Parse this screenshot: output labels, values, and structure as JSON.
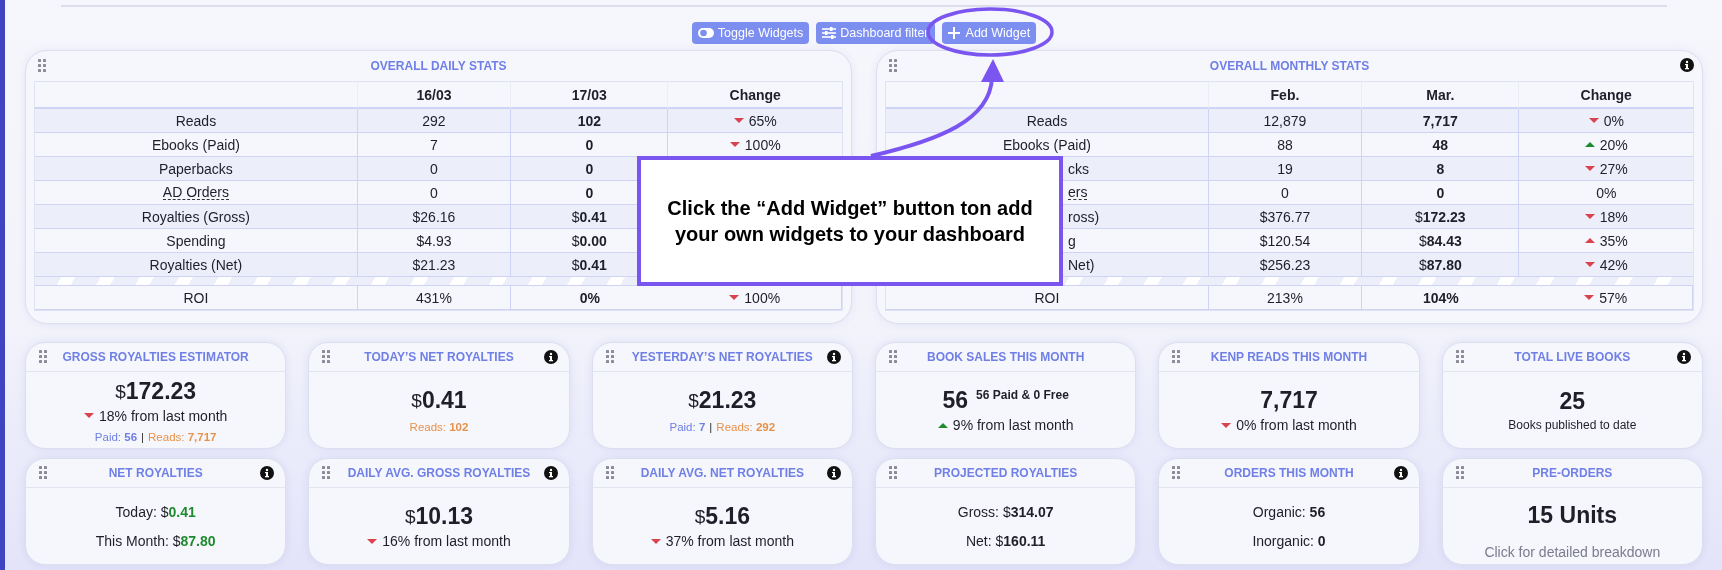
{
  "toolbar": {
    "buttons": [
      {
        "kind": "toggle",
        "label": "Toggle Widgets"
      },
      {
        "kind": "filter",
        "label": "Dashboard filter"
      },
      {
        "kind": "add",
        "label": "Add Widget"
      }
    ]
  },
  "daily_stats": {
    "title": "OVERALL DAILY STATS",
    "info": false,
    "columns": [
      "16/03",
      "17/03",
      "Change"
    ],
    "rows": [
      {
        "label": "Reads",
        "cut": false,
        "tooltip": false,
        "values": [
          "292",
          "102"
        ],
        "change": {
          "text": "65%",
          "arrow": true,
          "up": false,
          "color": "#d9434e"
        }
      },
      {
        "label": "Ebooks (Paid)",
        "cut": false,
        "tooltip": false,
        "values": [
          "7",
          "0"
        ],
        "change": {
          "text": "100%",
          "arrow": true,
          "up": false,
          "color": "#d9434e"
        }
      },
      {
        "label": "Paperbacks",
        "cut": false,
        "tooltip": false,
        "values": [
          "0",
          "0"
        ]
      },
      {
        "label": "AD Orders",
        "cut": false,
        "tooltip": true,
        "values": [
          "0",
          "0"
        ]
      },
      {
        "label": "Royalties (Gross)",
        "cut": false,
        "tooltip": false,
        "values": [
          {
            "prefix": "$",
            "text": "26.16"
          },
          {
            "prefix": "$",
            "text": "0.41"
          }
        ]
      },
      {
        "label": "Spending",
        "cut": false,
        "tooltip": false,
        "values": [
          {
            "prefix": "$",
            "text": "4.93"
          },
          {
            "prefix": "$",
            "text": "0.00"
          }
        ]
      },
      {
        "label": "Royalties (Net)",
        "cut": false,
        "tooltip": false,
        "values": [
          {
            "prefix": "$",
            "text": "21.23"
          },
          {
            "prefix": "$",
            "text": "0.41"
          }
        ]
      },
      {
        "label": "ROI",
        "cut": false,
        "tooltip": false,
        "values": [
          "431%",
          "0%"
        ],
        "change": {
          "text": "100%",
          "arrow": true,
          "up": false,
          "color": "#d9434e"
        }
      }
    ]
  },
  "monthly_stats": {
    "title": "OVERALL MONTHLY STATS",
    "info": true,
    "columns": [
      "Feb.",
      "Mar.",
      "Change"
    ],
    "rows": [
      {
        "label": "Reads",
        "cut": false,
        "tooltip": false,
        "values": [
          "12,879",
          "7,717"
        ],
        "change": {
          "text": "0%",
          "arrow": true,
          "up": false,
          "color": "#d9434e"
        }
      },
      {
        "label": "Ebooks (Paid)",
        "cut": false,
        "tooltip": false,
        "values": [
          "88",
          "48"
        ],
        "change": {
          "text": "20%",
          "arrow": true,
          "up": true,
          "color": "#1e8a2e"
        }
      },
      {
        "label": "cks",
        "cut": true,
        "tooltip": false,
        "values": [
          "19",
          "8"
        ],
        "change": {
          "text": "27%",
          "arrow": true,
          "up": false,
          "color": "#d9434e"
        }
      },
      {
        "label": "ers",
        "cut": true,
        "tooltip": true,
        "values": [
          "0",
          "0"
        ],
        "change": {
          "text": "0%",
          "arrow": false
        }
      },
      {
        "label": "ross)",
        "cut": true,
        "tooltip": false,
        "values": [
          {
            "prefix": "$",
            "text": "376.77"
          },
          {
            "prefix": "$",
            "text": "172.23"
          }
        ],
        "change": {
          "text": "18%",
          "arrow": true,
          "up": false,
          "color": "#d9434e"
        }
      },
      {
        "label": "g",
        "cut": true,
        "tooltip": false,
        "values": [
          {
            "prefix": "$",
            "text": "120.54"
          },
          {
            "prefix": "$",
            "text": "84.43"
          }
        ],
        "change": {
          "text": "35%",
          "arrow": true,
          "up": true,
          "color": "#d9434e"
        }
      },
      {
        "label": "Net)",
        "cut": true,
        "tooltip": false,
        "values": [
          {
            "prefix": "$",
            "text": "256.23"
          },
          {
            "prefix": "$",
            "text": "87.80"
          }
        ],
        "change": {
          "text": "42%",
          "arrow": true,
          "up": false,
          "color": "#d9434e"
        }
      },
      {
        "label": "ROI",
        "cut": false,
        "tooltip": false,
        "values": [
          "213%",
          "104%"
        ],
        "change": {
          "text": "57%",
          "arrow": true,
          "up": false,
          "color": "#d9434e"
        }
      }
    ]
  },
  "callout": {
    "text": "Click the “Add Widget” button ton add your own widgets to your dashboard"
  },
  "widgets": [
    {
      "kind": "amount",
      "title": "GROSS ROYALTIES ESTIMATOR",
      "info": false,
      "amount": {
        "prefix": "$",
        "text": "172.23"
      },
      "change": {
        "text": "18% from last month",
        "arrow": true,
        "up": false,
        "color": "#d9434e"
      },
      "footer": {
        "separator": "|",
        "parts": [
          {
            "label": "Paid:",
            "value": "56",
            "color": "#6f7fe6"
          },
          {
            "label": "Reads:",
            "value": "7,717",
            "color": "#e8914a"
          }
        ]
      }
    },
    {
      "kind": "amount",
      "title": "TODAY’S NET ROYALTIES",
      "info": true,
      "amount": {
        "prefix": "$",
        "text": "0.41"
      },
      "footer": {
        "parts": [
          {
            "label": "Reads:",
            "value": "102",
            "color": "#e8914a"
          }
        ]
      }
    },
    {
      "kind": "amount",
      "title": "YESTERDAY’S NET ROYALTIES",
      "info": true,
      "amount": {
        "prefix": "$",
        "text": "21.23"
      },
      "footer": {
        "separator": "|",
        "parts": [
          {
            "label": "Paid:",
            "value": "7",
            "color": "#6f7fe6"
          },
          {
            "label": "Reads:",
            "value": "292",
            "color": "#e8914a"
          }
        ]
      }
    },
    {
      "kind": "amount",
      "title": "BOOK SALES THIS MONTH",
      "info": false,
      "amount": {
        "text": "56",
        "note": "56 Paid & 0 Free"
      },
      "change": {
        "text": "9% from last month",
        "arrow": true,
        "up": true,
        "color": "#1e8a2e"
      }
    },
    {
      "kind": "amount",
      "title": "KENP READS THIS MONTH",
      "info": false,
      "amount": {
        "text": "7,717"
      },
      "change": {
        "text": "0% from last month",
        "arrow": true,
        "up": false,
        "color": "#d9434e"
      }
    },
    {
      "kind": "amount",
      "title": "TOTAL LIVE BOOKS",
      "info": true,
      "amount": {
        "text": "25"
      },
      "caption": "Books published to date"
    },
    {
      "kind": "lines",
      "title": "NET ROYALTIES",
      "info": true,
      "lines": [
        {
          "label": "Today:",
          "prefix": "$",
          "value": "0.41",
          "color": "#1e8a2e"
        },
        {
          "label": "This Month:",
          "prefix": "$",
          "value": "87.80",
          "color": "#1e8a2e"
        }
      ]
    },
    {
      "kind": "amount",
      "title": "DAILY AVG. GROSS ROYALTIES",
      "info": true,
      "amount": {
        "prefix": "$",
        "text": "10.13"
      },
      "change": {
        "text": "16% from last month",
        "arrow": true,
        "up": false,
        "color": "#d9434e"
      }
    },
    {
      "kind": "amount",
      "title": "DAILY AVG. NET ROYALTIES",
      "info": true,
      "amount": {
        "prefix": "$",
        "text": "5.16"
      },
      "change": {
        "text": "37% from last month",
        "arrow": true,
        "up": false,
        "color": "#d9434e"
      }
    },
    {
      "kind": "lines",
      "title": "PROJECTED ROYALTIES",
      "info": false,
      "lines": [
        {
          "label": "Gross:",
          "prefix": "$",
          "value": "314.07",
          "color": "#1f1f2a"
        },
        {
          "label": "Net:",
          "prefix": "$",
          "value": "160.11",
          "color": "#1f1f2a"
        }
      ]
    },
    {
      "kind": "lines",
      "title": "ORDERS THIS MONTH",
      "info": true,
      "lines": [
        {
          "label": "Organic:",
          "value": "56",
          "color": "#1f1f2a"
        },
        {
          "label": "Inorganic:",
          "value": "0",
          "color": "#1f1f2a"
        }
      ]
    },
    {
      "kind": "amount",
      "title": "PRE-ORDERS",
      "info": false,
      "amount": {
        "text": "15 Units"
      },
      "hint": "Click for detailed breakdown"
    }
  ]
}
